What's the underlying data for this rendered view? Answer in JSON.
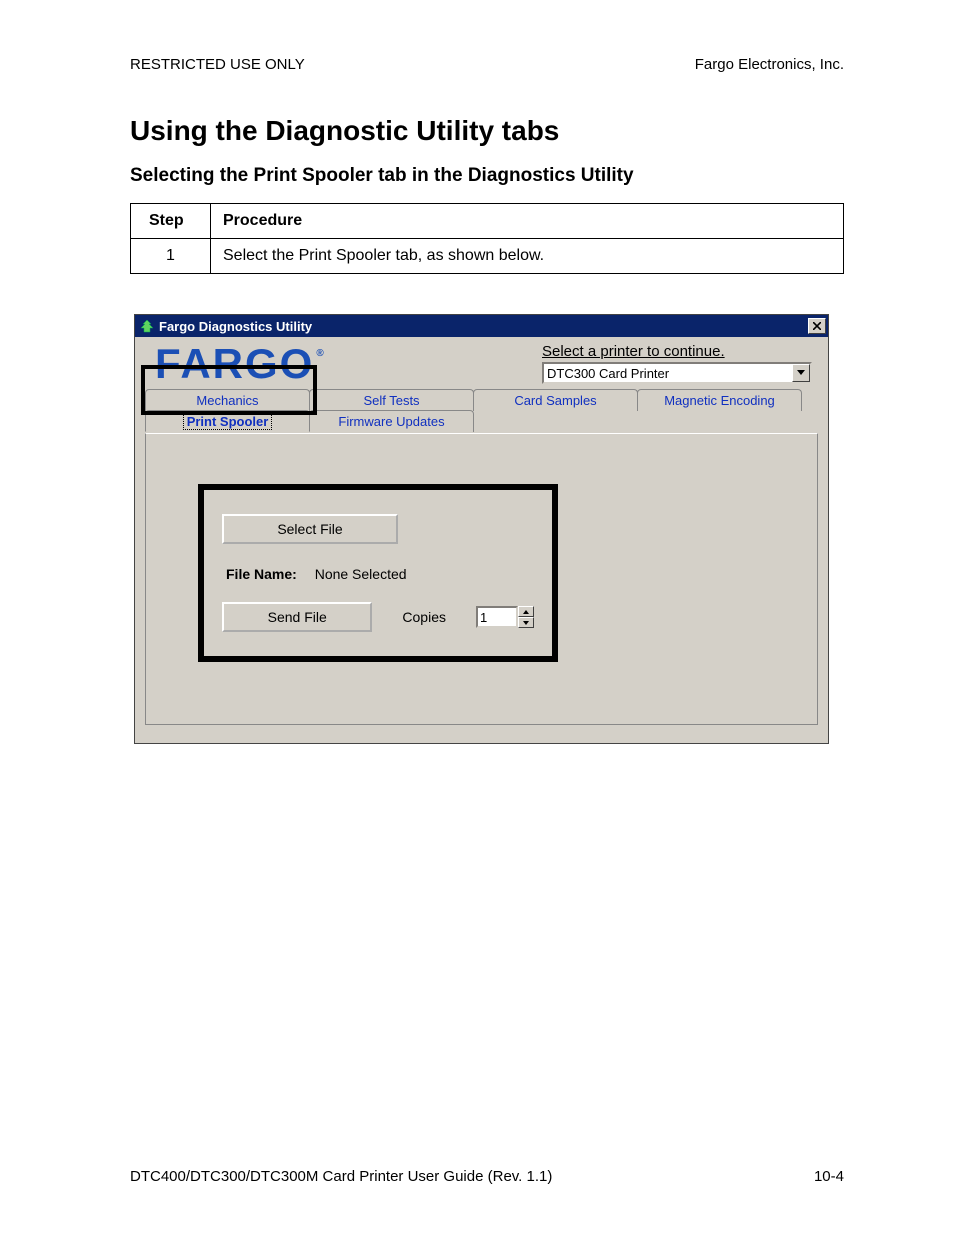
{
  "header": {
    "left": "RESTRICTED USE ONLY",
    "right": "Fargo Electronics, Inc."
  },
  "title": "Using the Diagnostic Utility tabs",
  "subtitle": "Selecting the Print Spooler tab in the Diagnostics Utility",
  "table": {
    "col_step": "Step",
    "col_proc": "Procedure",
    "rows": [
      {
        "step": "1",
        "proc": "Select the Print Spooler tab, as shown below."
      }
    ]
  },
  "window": {
    "title": "Fargo Diagnostics Utility",
    "logo": "FARGO",
    "printer_prompt": "Select a printer to continue.",
    "printer_value": "DTC300 Card Printer",
    "tabs_row1": [
      "Mechanics",
      "Self Tests",
      "Card Samples",
      "Magnetic Encoding"
    ],
    "tabs_row2": [
      "Print Spooler",
      "Firmware Updates"
    ],
    "active_tab": "Print Spooler",
    "select_file": "Select File",
    "file_name_label": "File Name:",
    "file_name_value": "None Selected",
    "send_file": "Send File",
    "copies_label": "Copies",
    "copies_value": "1"
  },
  "footer": {
    "left": "DTC400/DTC300/DTC300M Card Printer User Guide (Rev. 1.1)",
    "right": "10-4"
  }
}
